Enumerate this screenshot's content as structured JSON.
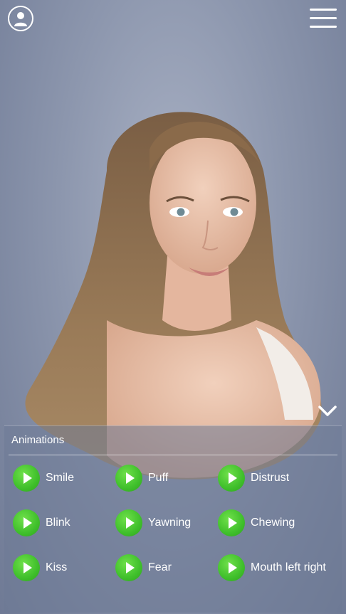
{
  "header": {
    "profile_icon": "user-icon",
    "menu_icon": "hamburger-menu-icon"
  },
  "avatar": {
    "hair_color": "#8a6a4a",
    "skin_color": "#e9c3ae"
  },
  "collapse_icon": "chevron-down-icon",
  "animations": {
    "title": "Animations",
    "items": [
      {
        "label": "Smile"
      },
      {
        "label": "Puff"
      },
      {
        "label": "Distrust"
      },
      {
        "label": "Blink"
      },
      {
        "label": "Yawning"
      },
      {
        "label": "Chewing"
      },
      {
        "label": "Kiss"
      },
      {
        "label": "Fear"
      },
      {
        "label": "Mouth left right"
      }
    ]
  },
  "colors": {
    "accent_green": "#47c22f",
    "background": "#8d97ae"
  }
}
